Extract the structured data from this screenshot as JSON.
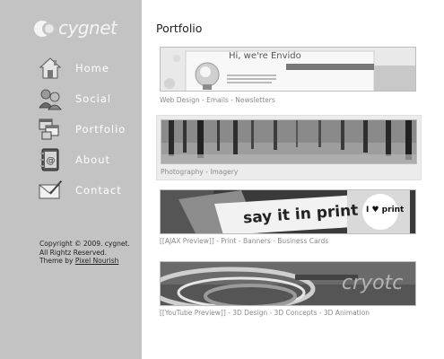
{
  "logo": {
    "text": "cygnet"
  },
  "nav": {
    "items": [
      {
        "label": "Home",
        "icon": "home-icon"
      },
      {
        "label": "Social",
        "icon": "users-icon"
      },
      {
        "label": "Portfolio",
        "icon": "windows-icon"
      },
      {
        "label": "About",
        "icon": "address-book-icon"
      },
      {
        "label": "Contact",
        "icon": "envelope-icon"
      }
    ]
  },
  "footer": {
    "line1": "Copyright © 2009. cygnet.",
    "line2": "All Rightz Reserved.",
    "theme_prefix": "Theme by ",
    "theme_link": "Pixel Nourish"
  },
  "page": {
    "title": "Portfolio"
  },
  "portfolio": {
    "items": [
      {
        "caption": "Web Design - Emails - Newsletters",
        "thumb_text": "Hi, we're Envido"
      },
      {
        "caption": "Photography - Imagery"
      },
      {
        "caption": "[[AJAX Preview]] - Print - Banners - Business Cards",
        "thumb_text": "say it in print",
        "thumb_badge": "I ♥ print"
      },
      {
        "caption": "[[YouTube Preview]] - 3D Design - 3D Concepts - 3D Animation",
        "thumb_text": "cryotc"
      }
    ]
  },
  "colors": {
    "sidebar": "#c3c3c3",
    "caption": "#8a8a8a",
    "title": "#222222"
  }
}
